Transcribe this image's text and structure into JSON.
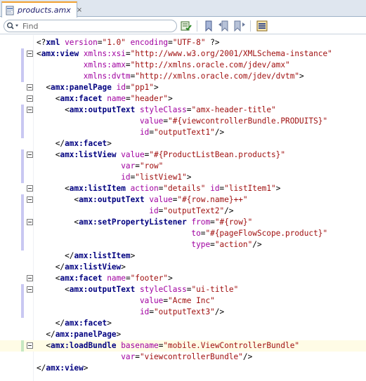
{
  "tab": {
    "label": "products.amx",
    "close": "×"
  },
  "toolbar": {
    "search_placeholder": "Find"
  },
  "code_lines": [
    [
      {
        "c": "p",
        "s": "<?"
      },
      {
        "c": "t",
        "s": "xml"
      },
      {
        "c": "p",
        "s": " "
      },
      {
        "c": "a",
        "s": "version"
      },
      {
        "c": "p",
        "s": "="
      },
      {
        "c": "v",
        "s": "\"1.0\""
      },
      {
        "c": "p",
        "s": " "
      },
      {
        "c": "a",
        "s": "encoding"
      },
      {
        "c": "p",
        "s": "="
      },
      {
        "c": "v",
        "s": "\"UTF-8\""
      },
      {
        "c": "p",
        "s": " ?>"
      }
    ],
    [
      {
        "c": "p",
        "s": "<"
      },
      {
        "c": "t",
        "s": "amx:view"
      },
      {
        "c": "p",
        "s": " "
      },
      {
        "c": "a",
        "s": "xmlns:xsi"
      },
      {
        "c": "p",
        "s": "="
      },
      {
        "c": "v",
        "s": "\"http://www.w3.org/2001/XMLSchema-instance\""
      }
    ],
    [
      {
        "c": "p",
        "s": "          "
      },
      {
        "c": "a",
        "s": "xmlns:amx"
      },
      {
        "c": "p",
        "s": "="
      },
      {
        "c": "v",
        "s": "\"http://xmlns.oracle.com/jdev/amx\""
      }
    ],
    [
      {
        "c": "p",
        "s": "          "
      },
      {
        "c": "a",
        "s": "xmlns:dvtm"
      },
      {
        "c": "p",
        "s": "="
      },
      {
        "c": "v",
        "s": "\"http://xmlns.oracle.com/jdev/dvtm\""
      },
      {
        "c": "p",
        "s": ">"
      }
    ],
    [
      {
        "c": "p",
        "s": "  <"
      },
      {
        "c": "t",
        "s": "amx:panelPage"
      },
      {
        "c": "p",
        "s": " "
      },
      {
        "c": "a",
        "s": "id"
      },
      {
        "c": "p",
        "s": "="
      },
      {
        "c": "v",
        "s": "\"pp1\""
      },
      {
        "c": "p",
        "s": ">"
      }
    ],
    [
      {
        "c": "p",
        "s": "    <"
      },
      {
        "c": "t",
        "s": "amx:facet"
      },
      {
        "c": "p",
        "s": " "
      },
      {
        "c": "a",
        "s": "name"
      },
      {
        "c": "p",
        "s": "="
      },
      {
        "c": "v",
        "s": "\"header\""
      },
      {
        "c": "p",
        "s": ">"
      }
    ],
    [
      {
        "c": "p",
        "s": "      <"
      },
      {
        "c": "t",
        "s": "amx:outputText"
      },
      {
        "c": "p",
        "s": " "
      },
      {
        "c": "a",
        "s": "styleClass"
      },
      {
        "c": "p",
        "s": "="
      },
      {
        "c": "v",
        "s": "\"amx-header-title\""
      }
    ],
    [
      {
        "c": "p",
        "s": "                      "
      },
      {
        "c": "a",
        "s": "value"
      },
      {
        "c": "p",
        "s": "="
      },
      {
        "c": "v",
        "s": "\"#{viewcontrollerBundle.PRODUITS}\""
      }
    ],
    [
      {
        "c": "p",
        "s": "                      "
      },
      {
        "c": "a",
        "s": "id"
      },
      {
        "c": "p",
        "s": "="
      },
      {
        "c": "v",
        "s": "\"outputText1\""
      },
      {
        "c": "p",
        "s": "/>"
      }
    ],
    [
      {
        "c": "p",
        "s": "    </"
      },
      {
        "c": "t",
        "s": "amx:facet"
      },
      {
        "c": "p",
        "s": ">"
      }
    ],
    [
      {
        "c": "p",
        "s": "    <"
      },
      {
        "c": "t",
        "s": "amx:listView"
      },
      {
        "c": "p",
        "s": " "
      },
      {
        "c": "a",
        "s": "value"
      },
      {
        "c": "p",
        "s": "="
      },
      {
        "c": "v",
        "s": "\"#{ProductListBean.products}\""
      }
    ],
    [
      {
        "c": "p",
        "s": "                  "
      },
      {
        "c": "a",
        "s": "var"
      },
      {
        "c": "p",
        "s": "="
      },
      {
        "c": "v",
        "s": "\"row\""
      }
    ],
    [
      {
        "c": "p",
        "s": "                  "
      },
      {
        "c": "a",
        "s": "id"
      },
      {
        "c": "p",
        "s": "="
      },
      {
        "c": "v",
        "s": "\"listView1\""
      },
      {
        "c": "p",
        "s": ">"
      }
    ],
    [
      {
        "c": "p",
        "s": "      <"
      },
      {
        "c": "t",
        "s": "amx:listItem"
      },
      {
        "c": "p",
        "s": " "
      },
      {
        "c": "a",
        "s": "action"
      },
      {
        "c": "p",
        "s": "="
      },
      {
        "c": "v",
        "s": "\"details\""
      },
      {
        "c": "p",
        "s": " "
      },
      {
        "c": "a",
        "s": "id"
      },
      {
        "c": "p",
        "s": "="
      },
      {
        "c": "v",
        "s": "\"listItem1\""
      },
      {
        "c": "p",
        "s": ">"
      }
    ],
    [
      {
        "c": "p",
        "s": "        <"
      },
      {
        "c": "t",
        "s": "amx:outputText"
      },
      {
        "c": "p",
        "s": " "
      },
      {
        "c": "a",
        "s": "value"
      },
      {
        "c": "p",
        "s": "="
      },
      {
        "c": "v",
        "s": "\"#{row.name}++\""
      }
    ],
    [
      {
        "c": "p",
        "s": "                        "
      },
      {
        "c": "a",
        "s": "id"
      },
      {
        "c": "p",
        "s": "="
      },
      {
        "c": "v",
        "s": "\"outputText2\""
      },
      {
        "c": "p",
        "s": "/>"
      }
    ],
    [
      {
        "c": "p",
        "s": "        <"
      },
      {
        "c": "t",
        "s": "amx:setPropertyListener"
      },
      {
        "c": "p",
        "s": " "
      },
      {
        "c": "a",
        "s": "from"
      },
      {
        "c": "p",
        "s": "="
      },
      {
        "c": "v",
        "s": "\"#{row}\""
      }
    ],
    [
      {
        "c": "p",
        "s": "                                 "
      },
      {
        "c": "a",
        "s": "to"
      },
      {
        "c": "p",
        "s": "="
      },
      {
        "c": "v",
        "s": "\"#{pageFlowScope.product}\""
      }
    ],
    [
      {
        "c": "p",
        "s": "                                 "
      },
      {
        "c": "a",
        "s": "type"
      },
      {
        "c": "p",
        "s": "="
      },
      {
        "c": "v",
        "s": "\"action\""
      },
      {
        "c": "p",
        "s": "/>"
      }
    ],
    [
      {
        "c": "p",
        "s": "      </"
      },
      {
        "c": "t",
        "s": "amx:listItem"
      },
      {
        "c": "p",
        "s": ">"
      }
    ],
    [
      {
        "c": "p",
        "s": "    </"
      },
      {
        "c": "t",
        "s": "amx:listView"
      },
      {
        "c": "p",
        "s": ">"
      }
    ],
    [
      {
        "c": "p",
        "s": "    <"
      },
      {
        "c": "t",
        "s": "amx:facet"
      },
      {
        "c": "p",
        "s": " "
      },
      {
        "c": "a",
        "s": "name"
      },
      {
        "c": "p",
        "s": "="
      },
      {
        "c": "v",
        "s": "\"footer\""
      },
      {
        "c": "p",
        "s": ">"
      }
    ],
    [
      {
        "c": "p",
        "s": "      <"
      },
      {
        "c": "t",
        "s": "amx:outputText"
      },
      {
        "c": "p",
        "s": " "
      },
      {
        "c": "a",
        "s": "styleClass"
      },
      {
        "c": "p",
        "s": "="
      },
      {
        "c": "v",
        "s": "\"ui-title\""
      }
    ],
    [
      {
        "c": "p",
        "s": "                      "
      },
      {
        "c": "a",
        "s": "value"
      },
      {
        "c": "p",
        "s": "="
      },
      {
        "c": "v",
        "s": "\"Acme Inc\""
      }
    ],
    [
      {
        "c": "p",
        "s": "                      "
      },
      {
        "c": "a",
        "s": "id"
      },
      {
        "c": "p",
        "s": "="
      },
      {
        "c": "v",
        "s": "\"outputText3\""
      },
      {
        "c": "p",
        "s": "/>"
      }
    ],
    [
      {
        "c": "p",
        "s": "    </"
      },
      {
        "c": "t",
        "s": "amx:facet"
      },
      {
        "c": "p",
        "s": ">"
      }
    ],
    [
      {
        "c": "p",
        "s": "  </"
      },
      {
        "c": "t",
        "s": "amx:panelPage"
      },
      {
        "c": "p",
        "s": ">"
      }
    ],
    [
      {
        "c": "p",
        "s": "  <"
      },
      {
        "c": "t",
        "s": "amx:loadBundle"
      },
      {
        "c": "p",
        "s": " "
      },
      {
        "c": "a",
        "s": "basename"
      },
      {
        "c": "p",
        "s": "="
      },
      {
        "c": "v",
        "s": "\"mobile.ViewControllerBundle\""
      }
    ],
    [
      {
        "c": "p",
        "s": "                  "
      },
      {
        "c": "a",
        "s": "var"
      },
      {
        "c": "p",
        "s": "="
      },
      {
        "c": "v",
        "s": "\"viewcontrollerBundle\""
      },
      {
        "c": "p",
        "s": "/>"
      }
    ],
    [
      {
        "c": "p",
        "s": "</"
      },
      {
        "c": "t",
        "s": "amx:view"
      },
      {
        "c": "p",
        "s": ">"
      }
    ]
  ],
  "folds": [
    1,
    4,
    5,
    6,
    10,
    13,
    14,
    16,
    21,
    22,
    27
  ],
  "modified_lines": [
    1,
    2,
    3,
    6,
    7,
    8,
    10,
    11,
    12,
    14,
    15,
    16,
    17,
    18,
    22,
    23,
    24
  ],
  "current_line": 27,
  "icons": [
    "file-amx-icon",
    "search-icon",
    "validate-icon",
    "bookmark-icon",
    "prev-bookmark-icon",
    "next-bookmark-icon",
    "toggle-view-icon"
  ],
  "colors": {
    "tag": "#000080",
    "attribute": "#a000a0",
    "value": "#a01010",
    "current_line_bg": "#fffce6",
    "active_tab_accent": "#f0a030"
  }
}
